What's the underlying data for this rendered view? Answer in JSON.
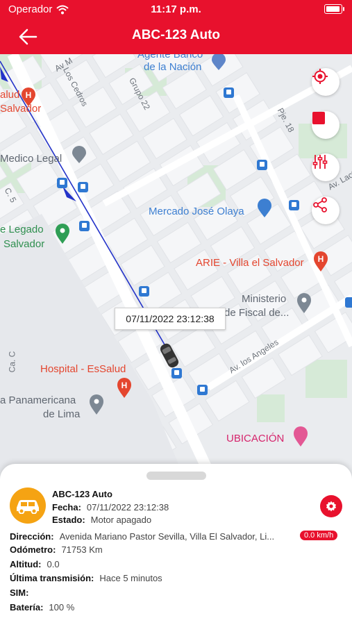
{
  "status_bar": {
    "carrier": "Operador",
    "time": "11:17 p.m."
  },
  "header": {
    "title": "ABC-123 Auto"
  },
  "map": {
    "labels": {
      "agente_banco": "Agente Banco",
      "banco_nacion": "de la Nación",
      "alud": "alud",
      "salvador_left": "Salvador",
      "medico_legal": "Medico Legal",
      "mercado": "Mercado José Olaya",
      "legado": "e Legado",
      "legado_salvador": "Salvador",
      "arie": "ARIE - Villa el Salvador",
      "ministerio": "Ministerio",
      "fiscal": "de Fiscal de...",
      "hospital": "Hospital - EsSalud",
      "panamericana": "a Panamericana",
      "de_lima": "de Lima",
      "ubicacion": "UBICACIÓN"
    },
    "streets": {
      "av_m": "Av M",
      "los_cedros": "Los Cedros",
      "grupo_22": "Grupo 22",
      "pje_18": "Pje. 18",
      "av_lactor": "Av. Lactor",
      "c5": "C. 5",
      "ca_c": "Ca. C",
      "av_los_angeles": "Av. los Angeles"
    },
    "tooltip": "07/11/2022 23:12:38"
  },
  "details": {
    "vehicle_name": "ABC-123 Auto",
    "fecha_label": "Fecha:",
    "fecha_value": "07/11/2022 23:12:38",
    "estado_label": "Estado:",
    "estado_value": "Motor apagado",
    "speed": "0.0 km/h",
    "direccion_label": "Dirección:",
    "direccion_value": "Avenida Mariano Pastor Sevilla, Villa El Salvador, Li...",
    "odometro_label": "Odómetro:",
    "odometro_value": "71753 Km",
    "altitud_label": "Altitud:",
    "altitud_value": "0.0",
    "ultima_label": "Última transmisión:",
    "ultima_value": "Hace 5 minutos",
    "sim_label": "SIM:",
    "sim_value": "",
    "bateria_label": "Batería:",
    "bateria_value": "100 %"
  },
  "icons": {
    "back": "arrow-left-icon",
    "locate": "target-icon",
    "stop": "stop-icon",
    "filter": "sliders-icon",
    "share": "share-icon",
    "settings": "gear-icon",
    "vehicle": "car-icon"
  },
  "colors": {
    "brand": "#e8112d",
    "avatar": "#f5a313",
    "route": "#2433c9",
    "poi_blue": "#3d7fd1",
    "poi_red": "#e4462f",
    "poi_green": "#2f8f4f"
  }
}
